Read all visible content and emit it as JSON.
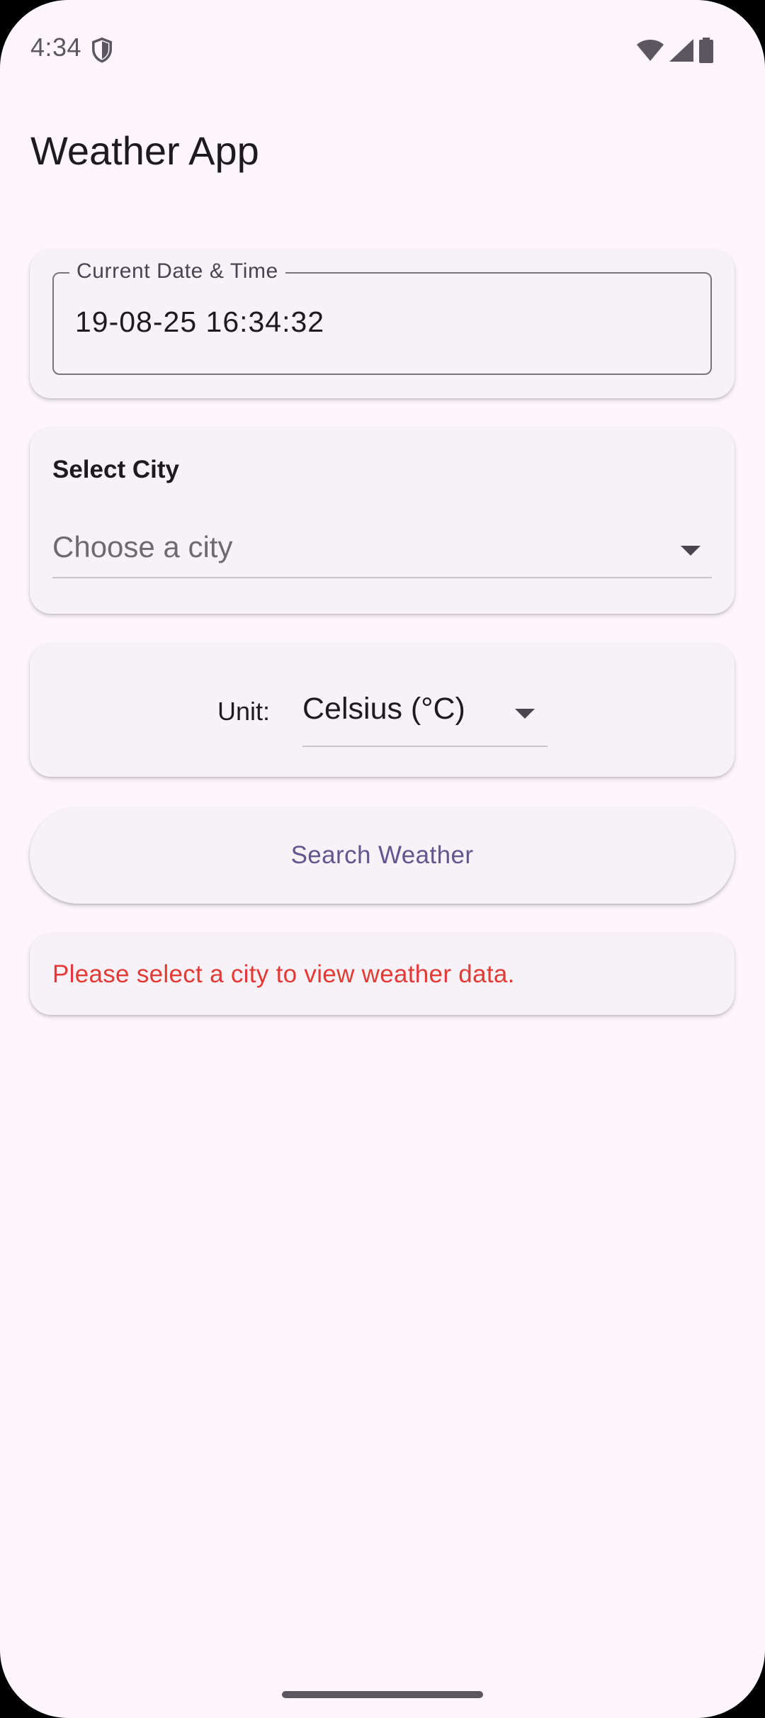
{
  "status_bar": {
    "time": "4:34",
    "icons": [
      "shield-icon",
      "wifi-icon",
      "cellular-signal-icon",
      "battery-icon"
    ]
  },
  "app_bar": {
    "title": "Weather App"
  },
  "datetime_field": {
    "label": "Current Date & Time",
    "value": "19-08-25 16:34:32"
  },
  "city_card": {
    "heading": "Select City",
    "dropdown_placeholder": "Choose a city",
    "dropdown_icon": "arrow-drop-down-icon"
  },
  "unit_card": {
    "label": "Unit:",
    "selected_value": "Celsius (°C)",
    "dropdown_icon": "arrow-drop-down-icon"
  },
  "search_button": {
    "label": "Search Weather"
  },
  "error_card": {
    "message": "Please select a city to view weather data."
  },
  "colors": {
    "background": "#fdf7fd",
    "card": "#f6f2f7",
    "accent": "#65558f",
    "error": "#e53935",
    "text_primary": "#1d1b20"
  }
}
